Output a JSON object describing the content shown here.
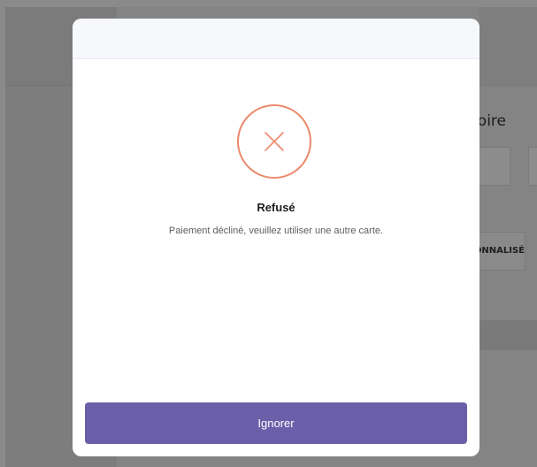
{
  "background_page": {
    "heading_fragment": "oire",
    "tab_fragment": "ONNALISÉ"
  },
  "modal": {
    "status_icon": "close-x-icon",
    "title": "Refusé",
    "message": "Paiement décliné, veuillez utiliser une autre carte.",
    "dismiss_label": "Ignorer"
  },
  "colors": {
    "overlay": "#848484",
    "icon_accent": "#ec8a6c",
    "button": "#6c5fa9",
    "header": "#f6f8fb"
  }
}
